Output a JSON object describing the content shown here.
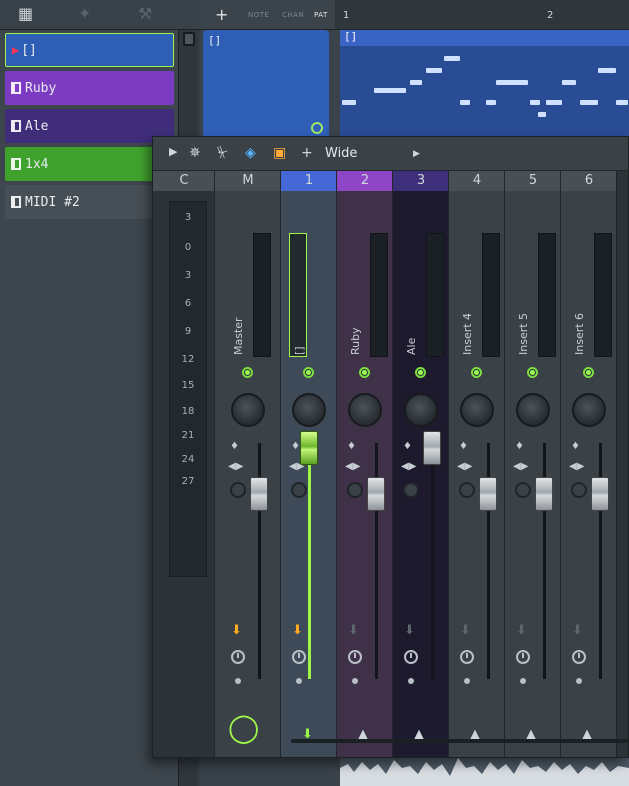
{
  "toolbar": {
    "icons": [
      "piano-roll-icon",
      "magic-icon",
      "wrench-icon"
    ]
  },
  "tracklist": {
    "tracks": [
      {
        "label": "[]",
        "color": "#2f5eb6",
        "selected": true
      },
      {
        "label": "Ruby",
        "color": "#7c3cc2"
      },
      {
        "label": "Ale",
        "color": "#3f2d7a"
      },
      {
        "label": "1x4",
        "color": "#3fa22d"
      },
      {
        "label": "MIDI #2",
        "color": "#474f56"
      }
    ]
  },
  "channel": {
    "tabs": [
      "NOTE",
      "CHAN",
      "PAT"
    ],
    "active_tab": "PAT",
    "pattern_title": "[]"
  },
  "timeline": {
    "bars": [
      "1",
      "2"
    ],
    "clip_title": "[]"
  },
  "mixer": {
    "toolbar": {
      "mode_label": "Wide"
    },
    "scale_labels": [
      "3",
      "0",
      "3",
      "6",
      "9",
      "12",
      "15",
      "18",
      "21",
      "24",
      "27"
    ],
    "strips": [
      {
        "num": "C",
        "label": ""
      },
      {
        "num": "M",
        "label": "Master"
      },
      {
        "num": "1",
        "label": "[]",
        "color": "#4568d6"
      },
      {
        "num": "2",
        "label": "Ruby",
        "color": "#8e45c6"
      },
      {
        "num": "3",
        "label": "Ale",
        "color": "#3e2f7a"
      },
      {
        "num": "4",
        "label": "Insert 4"
      },
      {
        "num": "5",
        "label": "Insert 5"
      },
      {
        "num": "6",
        "label": "Insert 6"
      }
    ]
  }
}
